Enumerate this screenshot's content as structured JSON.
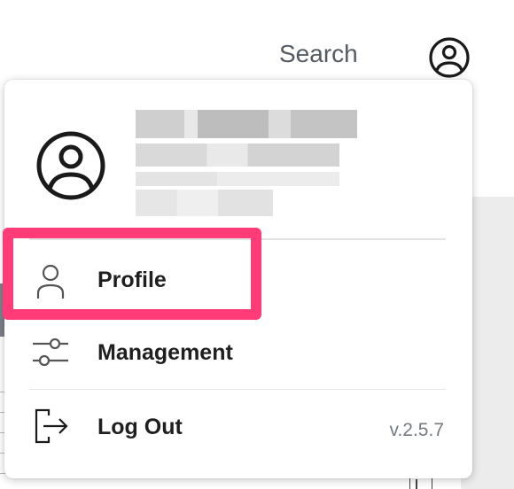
{
  "header": {
    "search_label": "Search",
    "account_icon": "account-circle-icon"
  },
  "dropdown": {
    "user_avatar_icon": "account-circle-icon",
    "user_info_redacted": true,
    "items": [
      {
        "label": "Profile",
        "icon": "person-outline-icon"
      },
      {
        "label": "Management",
        "icon": "sliders-icon",
        "highlighted": true
      },
      {
        "label": "Log Out",
        "icon": "logout-icon"
      }
    ],
    "version": "v.2.5.7"
  },
  "colors": {
    "highlight": "#ff3c78",
    "text": "#1f1f1f",
    "muted_text": "#757b82",
    "search_text": "#555b63"
  }
}
